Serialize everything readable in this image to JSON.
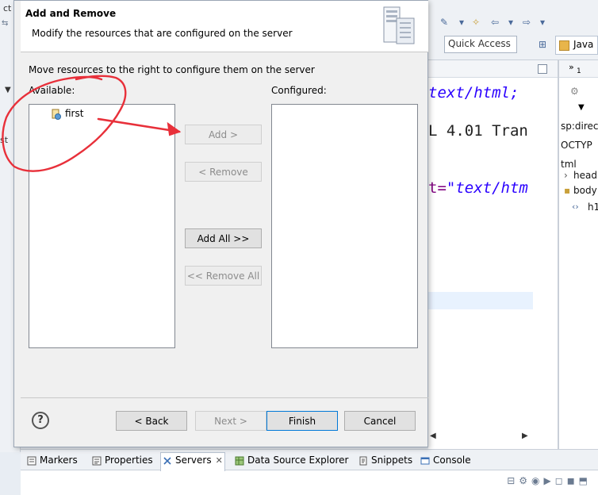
{
  "dialog": {
    "title": "Add and Remove",
    "description": "Modify the resources that are configured on the server",
    "instruction": "Move resources to the right to configure them on the server",
    "available_label": "Available:",
    "configured_label": "Configured:",
    "available_items": [
      "first"
    ],
    "buttons": {
      "add": "Add >",
      "remove": "< Remove",
      "add_all": "Add All >>",
      "remove_all": "<< Remove All",
      "back": "< Back",
      "next": "Next >",
      "finish": "Finish",
      "cancel": "Cancel"
    },
    "help_glyph": "?"
  },
  "ide": {
    "left_fragments": [
      "ct",
      "st"
    ],
    "quick_access": "Quick Access",
    "perspective": "Java",
    "editor_lines": [
      {
        "text": "text/html;"
      },
      {
        "text": "L 4.01 Tran"
      },
      {
        "prefix": "t=",
        "text": "\"text/htm"
      }
    ],
    "outline_items": [
      "sp:direc",
      "OCTYP",
      "tml",
      "head",
      "body",
      "h1"
    ],
    "outline_count": "1"
  },
  "bottom_tabs": [
    {
      "label": "Markers",
      "icon": "markers-icon"
    },
    {
      "label": "Properties",
      "icon": "properties-icon"
    },
    {
      "label": "Servers",
      "icon": "servers-icon",
      "active": true
    },
    {
      "label": "Data Source Explorer",
      "icon": "data-source-icon"
    },
    {
      "label": "Snippets",
      "icon": "snippets-icon"
    },
    {
      "label": "Console",
      "icon": "console-icon"
    }
  ],
  "colors": {
    "annotation_red": "#e8303a",
    "code_string": "#2a00ff",
    "focus_border": "#0078d7"
  }
}
